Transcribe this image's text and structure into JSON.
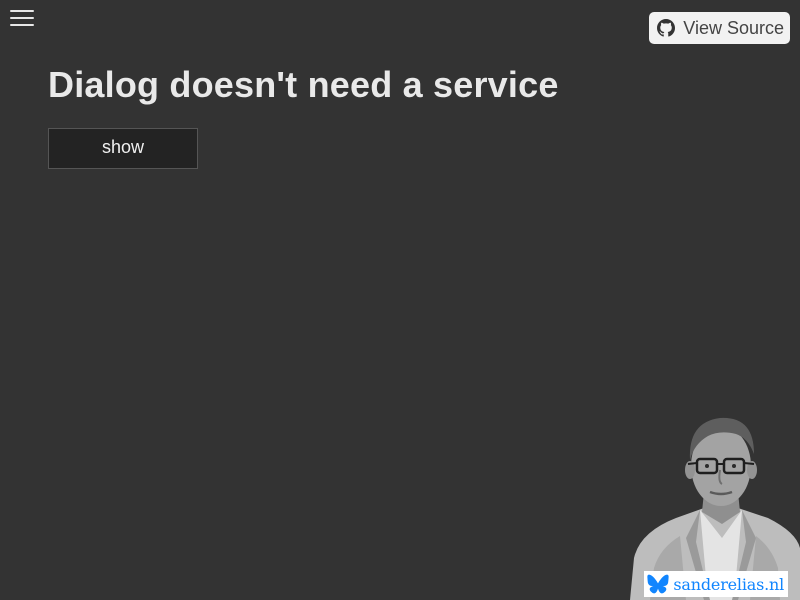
{
  "header": {
    "menu_icon": "hamburger-menu-icon",
    "view_source": {
      "label": "View Source",
      "icon": "github-icon"
    }
  },
  "main": {
    "title": "Dialog doesn't need a service",
    "show_button_label": "show"
  },
  "footer": {
    "author_photo_icon": "author-portrait",
    "site_badge": {
      "label": "sanderelias.nl",
      "icon": "butterfly-icon",
      "color": "#1185fe"
    }
  },
  "colors": {
    "background": "#333333",
    "title": "#e9e9e9",
    "button_bg": "#232323",
    "view_source_bg": "#f2f2f2",
    "bluesky_blue": "#1185fe"
  }
}
